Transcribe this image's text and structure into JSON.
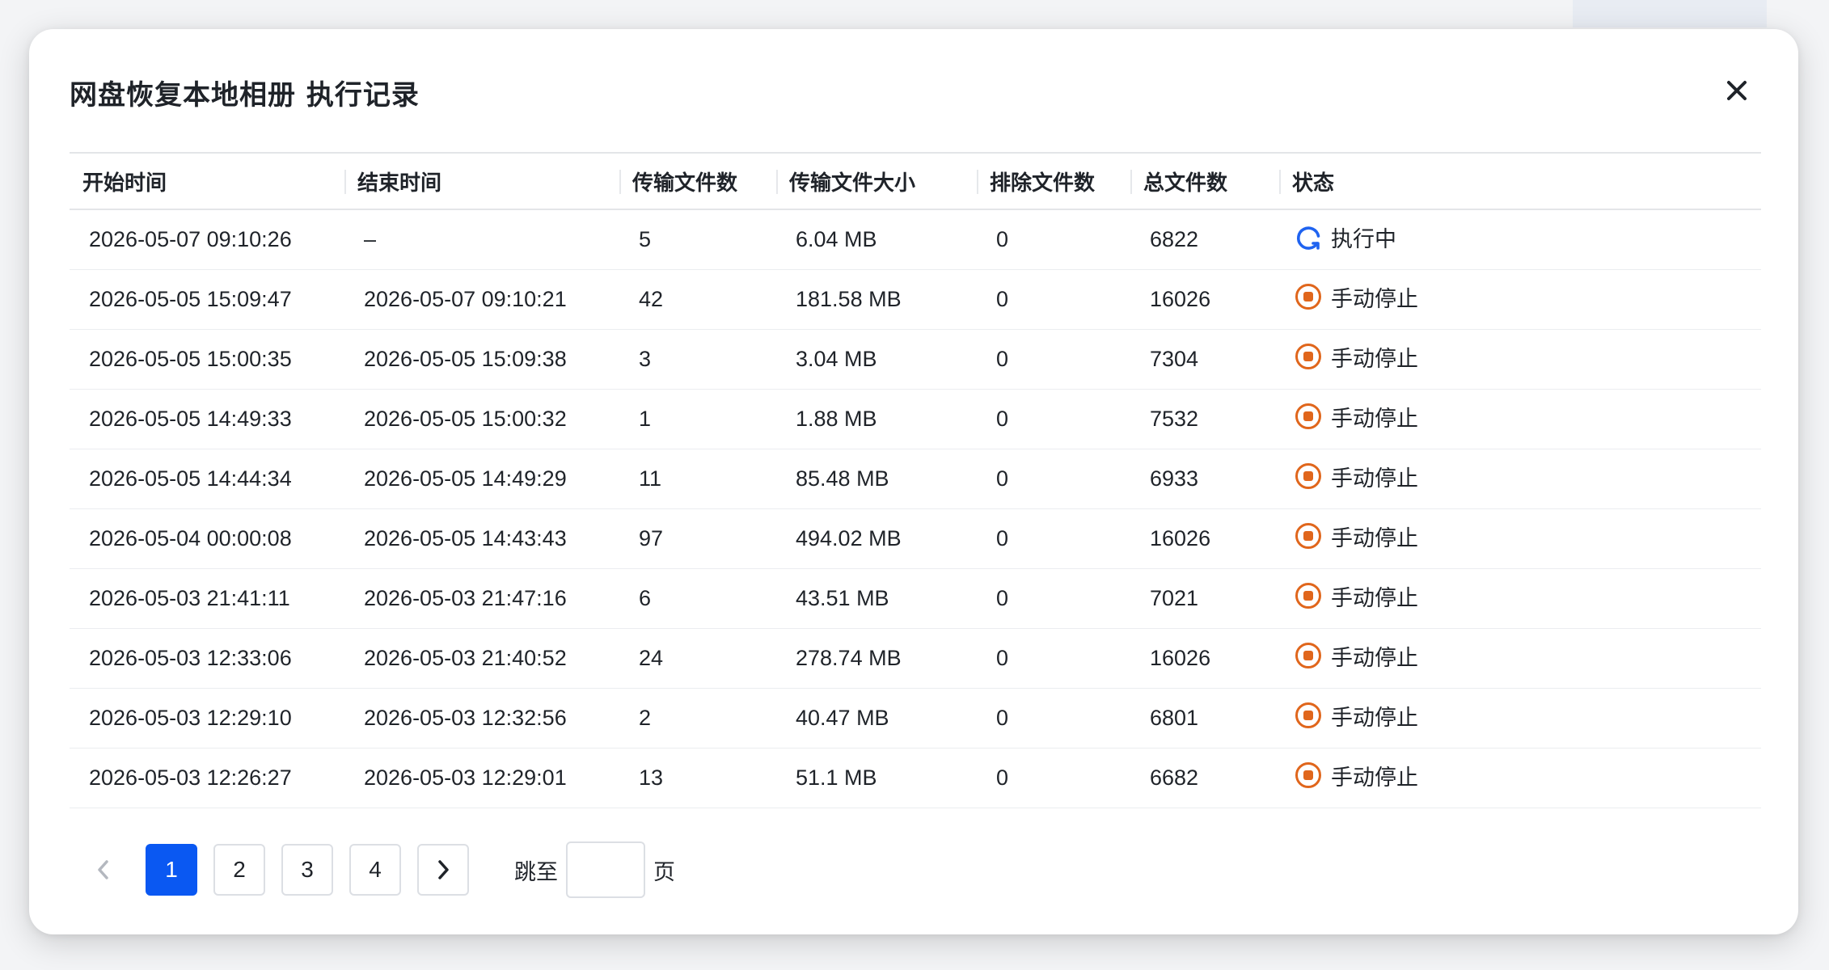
{
  "dialog": {
    "title": "网盘恢复本地相册 执行记录"
  },
  "table": {
    "headers": [
      "开始时间",
      "结束时间",
      "传输文件数",
      "传输文件大小",
      "排除文件数",
      "总文件数",
      "状态"
    ],
    "rows": [
      {
        "start": "2026-05-07 09:10:26",
        "end": "–",
        "count": "5",
        "size": "6.04 MB",
        "excluded": "0",
        "total": "6822",
        "status": "执行中",
        "status_type": "running"
      },
      {
        "start": "2026-05-05 15:09:47",
        "end": "2026-05-07 09:10:21",
        "count": "42",
        "size": "181.58 MB",
        "excluded": "0",
        "total": "16026",
        "status": "手动停止",
        "status_type": "stopped"
      },
      {
        "start": "2026-05-05 15:00:35",
        "end": "2026-05-05 15:09:38",
        "count": "3",
        "size": "3.04 MB",
        "excluded": "0",
        "total": "7304",
        "status": "手动停止",
        "status_type": "stopped"
      },
      {
        "start": "2026-05-05 14:49:33",
        "end": "2026-05-05 15:00:32",
        "count": "1",
        "size": "1.88 MB",
        "excluded": "0",
        "total": "7532",
        "status": "手动停止",
        "status_type": "stopped"
      },
      {
        "start": "2026-05-05 14:44:34",
        "end": "2026-05-05 14:49:29",
        "count": "11",
        "size": "85.48 MB",
        "excluded": "0",
        "total": "6933",
        "status": "手动停止",
        "status_type": "stopped"
      },
      {
        "start": "2026-05-04 00:00:08",
        "end": "2026-05-05 14:43:43",
        "count": "97",
        "size": "494.02 MB",
        "excluded": "0",
        "total": "16026",
        "status": "手动停止",
        "status_type": "stopped"
      },
      {
        "start": "2026-05-03 21:41:11",
        "end": "2026-05-03 21:47:16",
        "count": "6",
        "size": "43.51 MB",
        "excluded": "0",
        "total": "7021",
        "status": "手动停止",
        "status_type": "stopped"
      },
      {
        "start": "2026-05-03 12:33:06",
        "end": "2026-05-03 21:40:52",
        "count": "24",
        "size": "278.74 MB",
        "excluded": "0",
        "total": "16026",
        "status": "手动停止",
        "status_type": "stopped"
      },
      {
        "start": "2026-05-03 12:29:10",
        "end": "2026-05-03 12:32:56",
        "count": "2",
        "size": "40.47 MB",
        "excluded": "0",
        "total": "6801",
        "status": "手动停止",
        "status_type": "stopped"
      },
      {
        "start": "2026-05-03 12:26:27",
        "end": "2026-05-03 12:29:01",
        "count": "13",
        "size": "51.1 MB",
        "excluded": "0",
        "total": "6682",
        "status": "手动停止",
        "status_type": "stopped"
      }
    ]
  },
  "pagination": {
    "pages": [
      "1",
      "2",
      "3",
      "4"
    ],
    "current": "1",
    "jump_label": "跳至",
    "jump_suffix": "页",
    "jump_value": ""
  },
  "icons": {
    "close": "close-icon",
    "running": "refresh-icon",
    "stopped": "stop-circle-icon",
    "prev": "chevron-left-icon",
    "next": "chevron-right-icon"
  },
  "colors": {
    "accent": "#0a58f2",
    "running": "#1f63f0",
    "stopped": "#e0661c",
    "text": "#1f2329",
    "disabled": "#b4b8bf"
  }
}
